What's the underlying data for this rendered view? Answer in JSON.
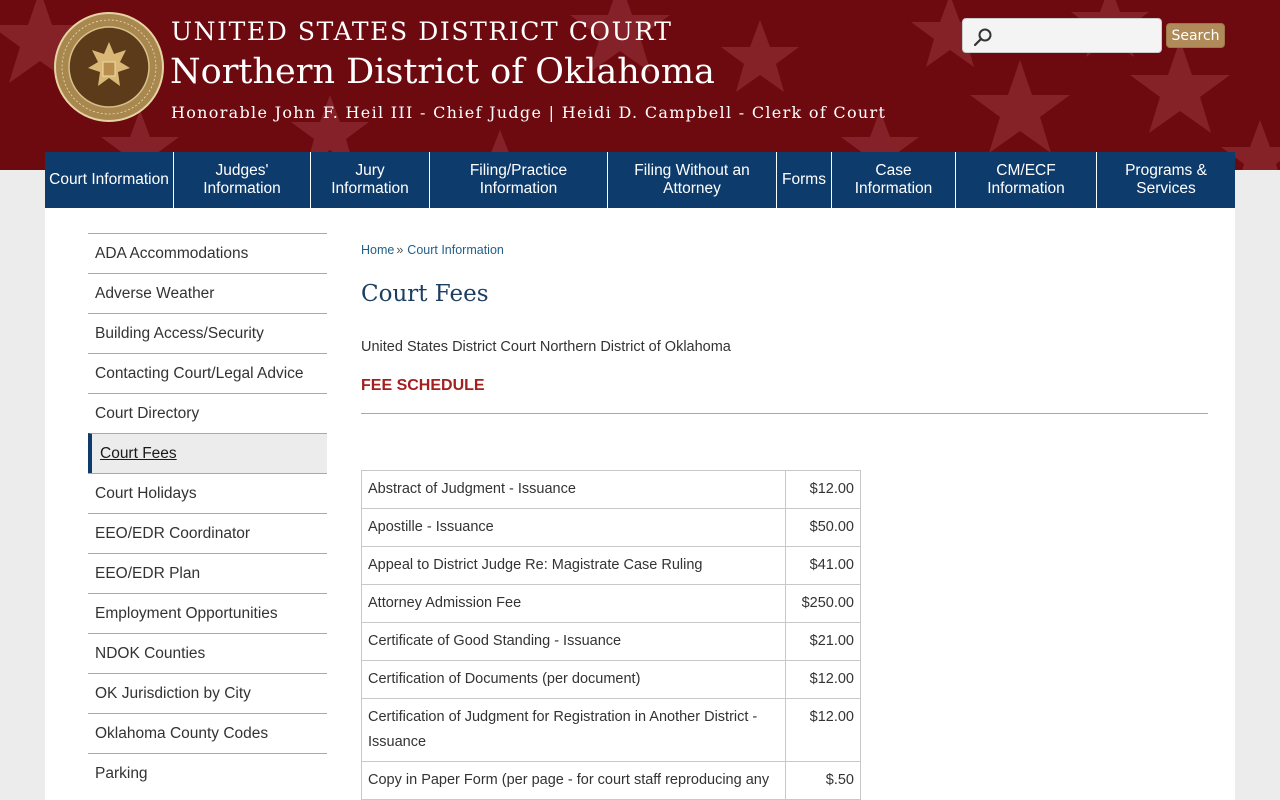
{
  "header": {
    "court_name": "UNITED STATES DISTRICT COURT",
    "district_name": "Northern District of Oklahoma",
    "judges_line": "Honorable John F. Heil III - Chief Judge | Heidi D. Campbell - Clerk of Court",
    "seal_icon": "court-seal-eagle-icon"
  },
  "search": {
    "placeholder": "",
    "button_label": "Search"
  },
  "nav": [
    {
      "label": "Court Information"
    },
    {
      "label": "Judges' Information"
    },
    {
      "label": "Jury Information"
    },
    {
      "label": "Filing/Practice Information"
    },
    {
      "label": "Filing Without an Attorney"
    },
    {
      "label": "Forms"
    },
    {
      "label": "Case Information"
    },
    {
      "label": "CM/ECF Information"
    },
    {
      "label": "Programs & Services"
    }
  ],
  "sidebar": {
    "items": [
      {
        "label": "ADA Accommodations"
      },
      {
        "label": "Adverse Weather"
      },
      {
        "label": "Building Access/Security"
      },
      {
        "label": "Contacting Court/Legal Advice"
      },
      {
        "label": "Court Directory"
      },
      {
        "label": "Court Fees"
      },
      {
        "label": "Court Holidays"
      },
      {
        "label": "EEO/EDR Coordinator"
      },
      {
        "label": "EEO/EDR Plan"
      },
      {
        "label": "Employment Opportunities"
      },
      {
        "label": "NDOK Counties"
      },
      {
        "label": "OK Jurisdiction by City"
      },
      {
        "label": "Oklahoma County Codes"
      },
      {
        "label": "Parking"
      }
    ],
    "active_index": 5
  },
  "breadcrumb": {
    "home": "Home",
    "separator": "»",
    "current": "Court Information"
  },
  "page": {
    "title": "Court Fees",
    "intro": "United States District Court Northern District of Oklahoma",
    "fee_heading": "FEE SCHEDULE"
  },
  "fees": [
    {
      "desc": "Abstract of Judgment - Issuance",
      "amount": "$12.00"
    },
    {
      "desc": "Apostille - Issuance",
      "amount": "$50.00"
    },
    {
      "desc": "Appeal to District Judge Re: Magistrate Case Ruling",
      "amount": "$41.00"
    },
    {
      "desc": "Attorney Admission Fee",
      "amount": "$250.00"
    },
    {
      "desc": "Certificate of Good Standing - Issuance",
      "amount": "$21.00"
    },
    {
      "desc": "Certification of Documents (per document)",
      "amount": "$12.00"
    },
    {
      "desc": "Certification of Judgment for Registration in Another District - Issuance",
      "amount": "$12.00"
    },
    {
      "desc": "Copy in Paper Form (per page - for court staff reproducing any",
      "amount": "$.50"
    }
  ],
  "colors": {
    "header_bg": "#6d0a10",
    "nav_bg": "#0d3b6b",
    "accent_red": "#a3201f",
    "search_button": "#b08a58"
  }
}
